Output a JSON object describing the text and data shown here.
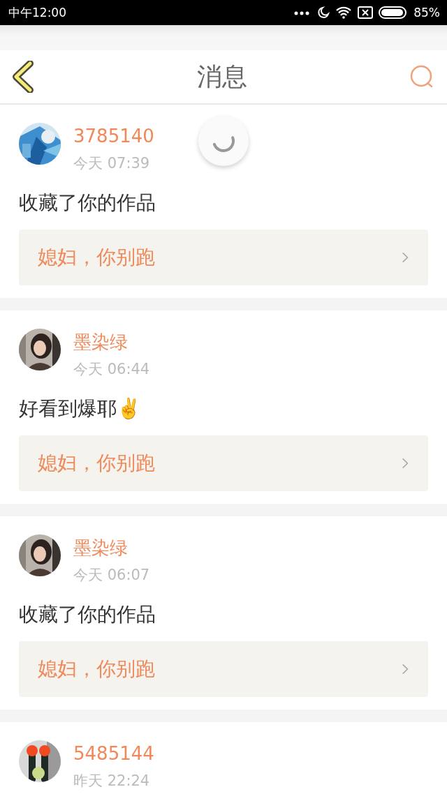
{
  "status_bar": {
    "time": "中午12:00",
    "battery": "85%"
  },
  "header": {
    "title": "消息"
  },
  "messages": [
    {
      "user": "3785140",
      "time": "今天 07:39",
      "text": "收藏了你的作品",
      "work": "媳妇，你别跑"
    },
    {
      "user": "墨染绿",
      "time": "今天 06:44",
      "text": "好看到爆耶✌️",
      "work": "媳妇，你别跑"
    },
    {
      "user": "墨染绿",
      "time": "今天 06:07",
      "text": "收藏了你的作品",
      "work": "媳妇，你别跑"
    },
    {
      "user": "5485144",
      "time": "昨天 22:24"
    }
  ]
}
